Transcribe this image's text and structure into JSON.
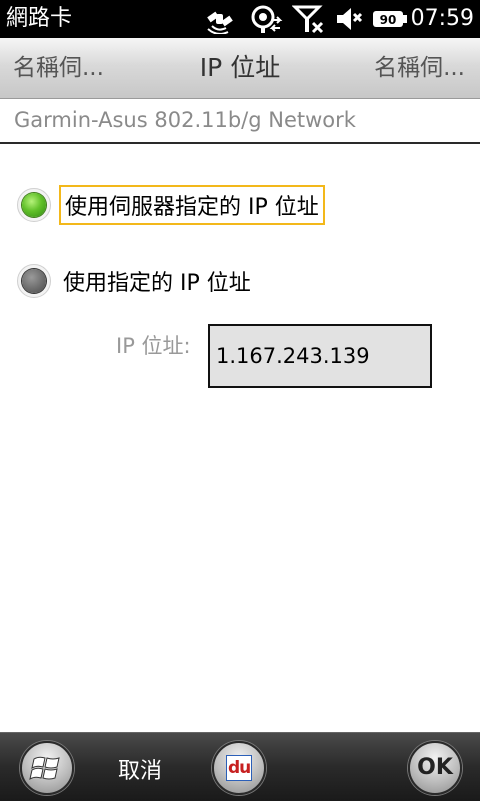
{
  "status_bar": {
    "title": "網路卡",
    "battery": "90",
    "time": "07:59",
    "icons": [
      "satellite-icon",
      "data-sync-icon",
      "no-signal-icon",
      "speaker-mute-icon",
      "battery-icon"
    ]
  },
  "tabs": {
    "left": "名稱伺...",
    "center": "IP 位址",
    "right": "名稱伺..."
  },
  "network_name": "Garmin-Asus 802.11b/g Network",
  "options": {
    "server_assigned": "使用伺服器指定的 IP 位址",
    "specific": "使用指定的 IP 位址",
    "selected": "server_assigned"
  },
  "ip": {
    "label": "IP 位址:",
    "value": "1.167.243.139"
  },
  "bottom_bar": {
    "cancel": "取消",
    "ok": "OK",
    "app_icon_text": "du"
  },
  "colors": {
    "focus_border": "#f3b81a",
    "radio_selected": "#62c12a",
    "radio_unselected": "#6d6d6d"
  }
}
